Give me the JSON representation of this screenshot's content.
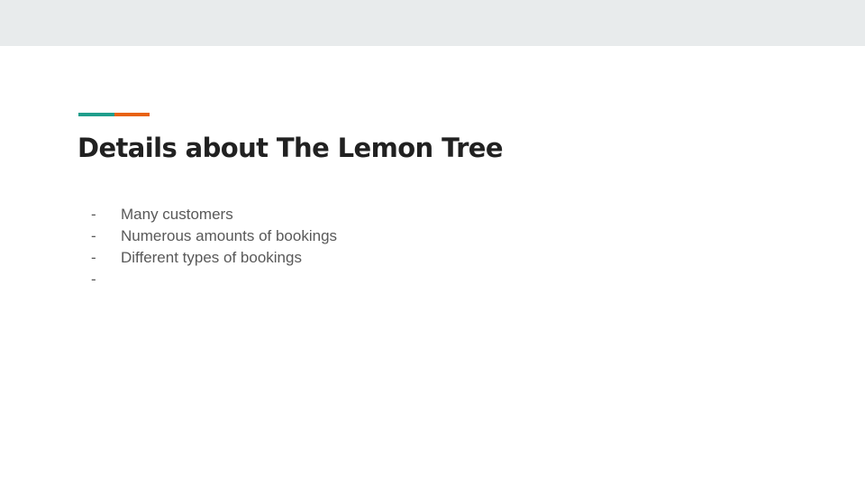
{
  "colors": {
    "band": "#e8ebec",
    "accent_teal": "#1f9e8c",
    "accent_orange": "#e8620f",
    "title": "#212121",
    "body_text": "#595959"
  },
  "slide": {
    "title": "Details about The Lemon Tree",
    "bullets": [
      {
        "marker": "-",
        "text": "Many customers"
      },
      {
        "marker": "-",
        "text": "Numerous amounts of bookings"
      },
      {
        "marker": "-",
        "text": "Different types of bookings"
      },
      {
        "marker": "-",
        "text": ""
      }
    ]
  }
}
